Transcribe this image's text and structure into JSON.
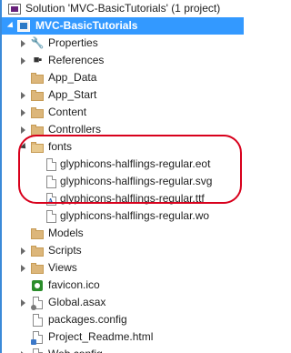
{
  "solution": {
    "label": "Solution 'MVC-BasicTutorials' (1 project)",
    "icon": "solution-icon"
  },
  "project": {
    "label": "MVC-BasicTutorials",
    "icon": "csharp-web-project-icon",
    "selected": true
  },
  "items": [
    {
      "label": "Properties",
      "icon": "wrench-icon",
      "expander": "collapsed"
    },
    {
      "label": "References",
      "icon": "references-icon",
      "expander": "collapsed"
    },
    {
      "label": "App_Data",
      "icon": "folder-icon",
      "expander": "none"
    },
    {
      "label": "App_Start",
      "icon": "folder-icon",
      "expander": "collapsed"
    },
    {
      "label": "Content",
      "icon": "folder-icon",
      "expander": "collapsed"
    },
    {
      "label": "Controllers",
      "icon": "folder-icon",
      "expander": "collapsed"
    },
    {
      "label": "fonts",
      "icon": "folder-open-icon",
      "expander": "expanded",
      "children": [
        {
          "label": "glyphicons-halflings-regular.eot",
          "icon": "file-icon"
        },
        {
          "label": "glyphicons-halflings-regular.svg",
          "icon": "file-icon"
        },
        {
          "label": "glyphicons-halflings-regular.ttf",
          "icon": "font-file-icon"
        },
        {
          "label": "glyphicons-halflings-regular.wo",
          "icon": "file-icon"
        }
      ]
    },
    {
      "label": "Models",
      "icon": "folder-icon",
      "expander": "none"
    },
    {
      "label": "Scripts",
      "icon": "folder-icon",
      "expander": "collapsed"
    },
    {
      "label": "Views",
      "icon": "folder-icon",
      "expander": "collapsed"
    },
    {
      "label": "favicon.ico",
      "icon": "favicon-icon",
      "expander": "none"
    },
    {
      "label": "Global.asax",
      "icon": "asax-file-icon",
      "expander": "collapsed"
    },
    {
      "label": "packages.config",
      "icon": "config-file-icon",
      "expander": "none"
    },
    {
      "label": "Project_Readme.html",
      "icon": "html-file-icon",
      "expander": "none"
    },
    {
      "label": "Web.config",
      "icon": "web-config-icon",
      "expander": "collapsed"
    }
  ],
  "colors": {
    "selection": "#3399ff",
    "highlight_circle": "#d8001c",
    "folder": "#dcb67a"
  }
}
